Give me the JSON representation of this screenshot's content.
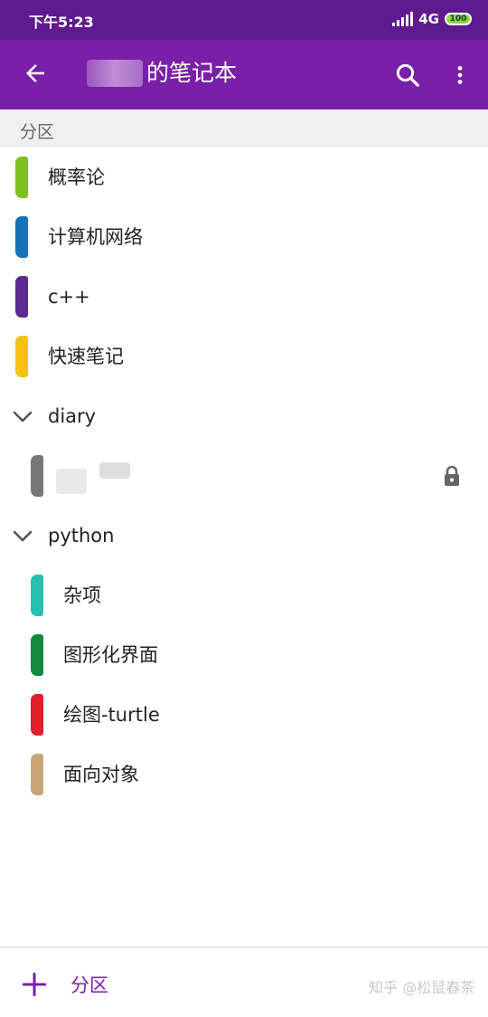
{
  "status_bar": {
    "time": "下午5:23",
    "network": "4G",
    "battery": "100"
  },
  "app_bar": {
    "title": "的笔记本",
    "icons": [
      "back-arrow-icon",
      "search-icon",
      "more-vert-icon"
    ]
  },
  "section_header": "分区",
  "sections": [
    {
      "label": "概率论",
      "color": "#7dc21e"
    },
    {
      "label": "计算机网络",
      "color": "#1472b8"
    },
    {
      "label": "c++",
      "color": "#5c2a91"
    },
    {
      "label": "快速笔记",
      "color": "#f5c211"
    }
  ],
  "groups": [
    {
      "label": "diary",
      "children": [
        {
          "label": "",
          "color": "#777777",
          "locked": true
        }
      ]
    },
    {
      "label": "python",
      "children": [
        {
          "label": "杂项",
          "color": "#26c0b0"
        },
        {
          "label": "图形化界面",
          "color": "#108a3e"
        },
        {
          "label": "绘图-turtle",
          "color": "#e31e2b"
        },
        {
          "label": "面向对象",
          "color": "#c8a476"
        }
      ]
    }
  ],
  "bottom_bar": {
    "add_label": "分区",
    "watermark": "知乎 @松鼠春茶"
  },
  "colors": {
    "status_bar": "#5f1a8f",
    "app_bar": "#7a1fa8",
    "accent": "#7a1fa8"
  }
}
